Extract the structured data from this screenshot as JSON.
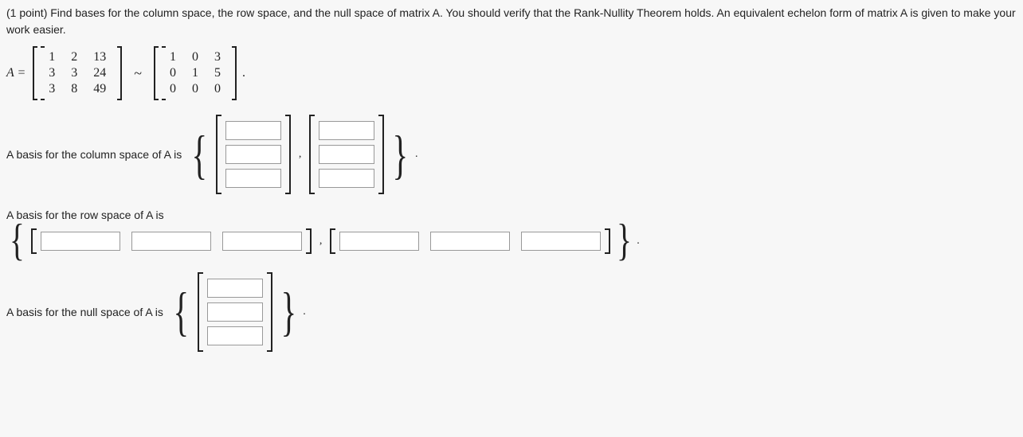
{
  "question": {
    "prefix": "(1 point) Find bases for the column space, the row space, and the null space of matrix A. You should verify that the Rank-Nullity Theorem holds. An equivalent echelon form of matrix A is given to make your work easier."
  },
  "matrixA": {
    "label": "A =",
    "rows": [
      [
        "1",
        "2",
        "13"
      ],
      [
        "3",
        "3",
        "24"
      ],
      [
        "3",
        "8",
        "49"
      ]
    ]
  },
  "tilde": "~",
  "echelon": {
    "rows": [
      [
        "1",
        "0",
        "3"
      ],
      [
        "0",
        "1",
        "5"
      ],
      [
        "0",
        "0",
        "0"
      ]
    ]
  },
  "labels": {
    "colspace": "A basis for the column space of A is",
    "rowspace": "A basis for the row space of A is",
    "nullspace": "A basis for the null space of A is"
  },
  "braces": {
    "open": "{",
    "close": "}"
  },
  "sep": ",",
  "period": "."
}
